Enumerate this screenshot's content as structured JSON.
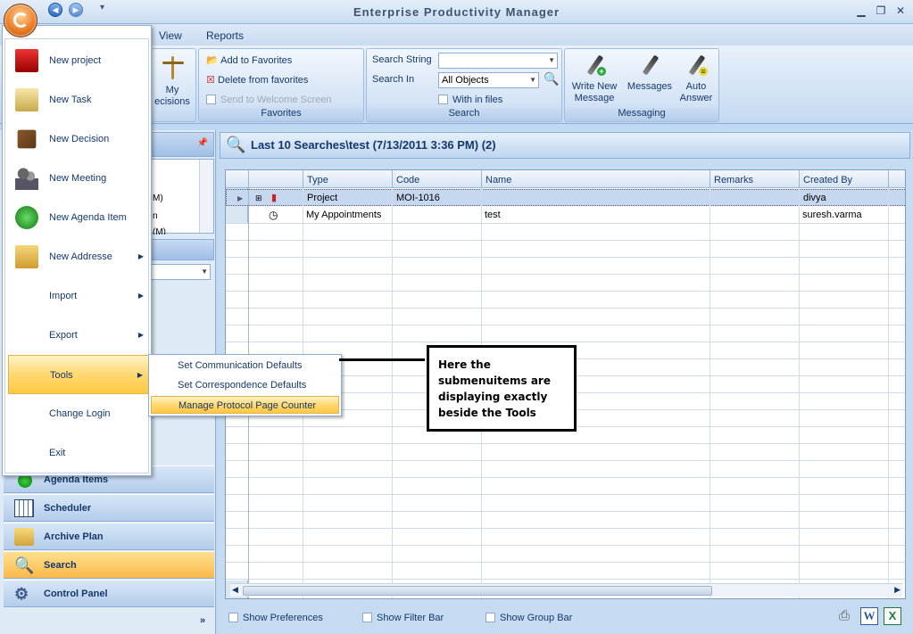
{
  "app": {
    "title": "Enterprise Productivity Manager"
  },
  "tabs": [
    "View",
    "Reports"
  ],
  "ribbon": {
    "my_decisions": {
      "line1": "My",
      "line2": "ecisions"
    },
    "favorites": {
      "add": "Add to Favorites",
      "delete": "Delete from favorites",
      "send": "Send to Welcome Screen",
      "label": "Favorites"
    },
    "search": {
      "search_string_label": "Search String",
      "search_string_value": "",
      "search_in_label": "Search In",
      "search_in_value": "All Objects",
      "with_in_files": "With in files",
      "label": "Search"
    },
    "messaging": {
      "write_line1": "Write New",
      "write_line2": "Message",
      "messages": "Messages",
      "auto_line1": "Auto",
      "auto_line2": "Answer",
      "label": "Messaging"
    }
  },
  "left": {
    "partial_rows": [
      "M)",
      "n",
      "(M)"
    ],
    "nav": {
      "agenda": "Agenda Items",
      "scheduler": "Scheduler",
      "archive": "Archive Plan",
      "search": "Search",
      "control": "Control Panel"
    }
  },
  "main": {
    "header": "Last 10 Searches\\test (7/13/2011 3:36 PM) (2)",
    "columns": [
      "Type",
      "Code",
      "Name",
      "Remarks",
      "Created By"
    ],
    "rows": [
      {
        "type": "Project",
        "code": "MOI-1016",
        "name": "",
        "remarks": "",
        "created_by": "divya"
      },
      {
        "type": "My Appointments",
        "code": "",
        "name": "test",
        "remarks": "",
        "created_by": "suresh.varma"
      }
    ]
  },
  "bottom": {
    "show_preferences": "Show Preferences",
    "show_filter_bar": "Show Filter Bar",
    "show_group_bar": "Show Group Bar"
  },
  "app_menu": {
    "items": [
      "New project",
      "New Task",
      "New Decision",
      "New Meeting",
      "New Agenda Item",
      "New Addresse",
      "Import",
      "Export",
      "Tools",
      "Change Login",
      "Exit"
    ]
  },
  "tools_submenu": [
    "Set Communication Defaults",
    "Set Correspondence Defaults",
    "Manage Protocol Page Counter"
  ],
  "callout": "Here the submenuitems are displaying exactly beside the Tools"
}
